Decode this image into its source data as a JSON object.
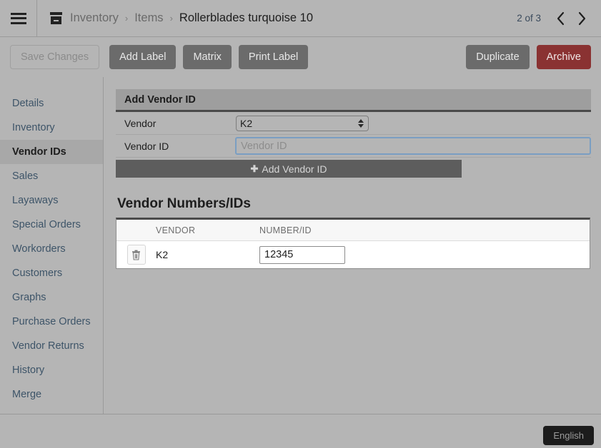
{
  "topbar": {
    "menu_icon": "hamburger-icon",
    "module_icon": "archive-box-icon",
    "breadcrumb": [
      "Inventory",
      "Items"
    ],
    "breadcrumb_current": "Rollerblades turquoise 10",
    "separator": "›",
    "pager_label": "2 of 3",
    "prev_icon": "chevron-left-icon",
    "next_icon": "chevron-right-icon"
  },
  "toolbar": {
    "save_label": "Save Changes",
    "add_label_label": "Add Label",
    "matrix_label": "Matrix",
    "print_label_label": "Print Label",
    "duplicate_label": "Duplicate",
    "archive_label": "Archive",
    "archive_color": "#8a3232",
    "button_color": "#6b6b6b"
  },
  "sidebar": {
    "items": [
      {
        "label": "Details",
        "active": false
      },
      {
        "label": "Inventory",
        "active": false
      },
      {
        "label": "Vendor IDs",
        "active": true
      },
      {
        "label": "Sales",
        "active": false
      },
      {
        "label": "Layaways",
        "active": false
      },
      {
        "label": "Special Orders",
        "active": false
      },
      {
        "label": "Workorders",
        "active": false
      },
      {
        "label": "Customers",
        "active": false
      },
      {
        "label": "Graphs",
        "active": false
      },
      {
        "label": "Purchase Orders",
        "active": false
      },
      {
        "label": "Vendor Returns",
        "active": false
      },
      {
        "label": "History",
        "active": false
      },
      {
        "label": "Merge",
        "active": false
      }
    ]
  },
  "add_panel": {
    "title": "Add Vendor ID",
    "vendor_label": "Vendor",
    "vendor_value": "K2",
    "vendor_options": [
      "K2"
    ],
    "vendor_id_label": "Vendor ID",
    "vendor_id_value": "",
    "vendor_id_placeholder": "Vendor ID",
    "add_button_label": "Add Vendor ID",
    "add_button_icon": "plus-icon"
  },
  "table_section": {
    "title": "Vendor Numbers/IDs",
    "columns": [
      "VENDOR",
      "NUMBER/ID"
    ],
    "rows": [
      {
        "delete_icon": "trash-icon",
        "vendor": "K2",
        "number": "12345"
      }
    ]
  },
  "footer": {
    "language_label": "English"
  }
}
